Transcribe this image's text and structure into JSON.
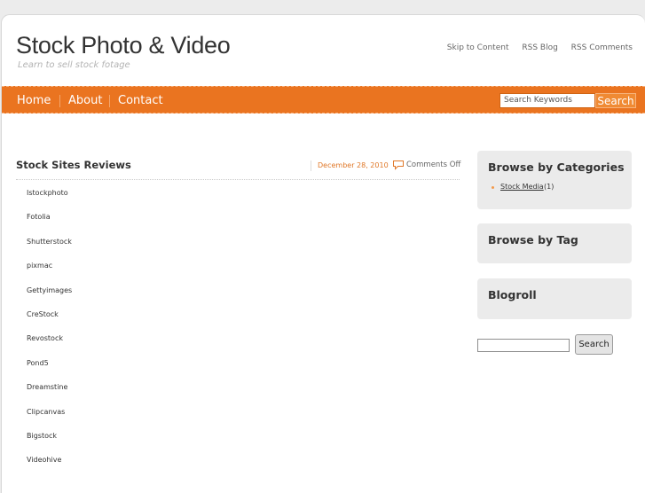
{
  "header": {
    "title": "Stock Photo & Video",
    "tagline": "Learn to sell stock fotage",
    "links": [
      "Skip to Content",
      "RSS Blog",
      "RSS Comments"
    ]
  },
  "nav": {
    "items": [
      "Home",
      "About",
      "Contact"
    ],
    "search_placeholder": "Search Keywords",
    "search_button": "Search"
  },
  "post": {
    "title": "Stock Sites Reviews",
    "date": "December 28, 2010",
    "comments": "Comments Off",
    "sites": [
      "Istockphoto",
      "Fotolia",
      "Shutterstock",
      "pixmac",
      "Gettyimages",
      "CreStock",
      "Revostock",
      "Pond5",
      "Dreamstine",
      "Clipcanvas",
      "Bigstock",
      "Videohive"
    ]
  },
  "sidebar": {
    "categories_title": "Browse by Categories",
    "categories": [
      {
        "name": "Stock Media",
        "count": "(1)"
      }
    ],
    "tags_title": "Browse by Tag",
    "blogroll_title": "Blogroll",
    "search_button": "Search"
  },
  "colors": {
    "accent": "#ea7420"
  }
}
